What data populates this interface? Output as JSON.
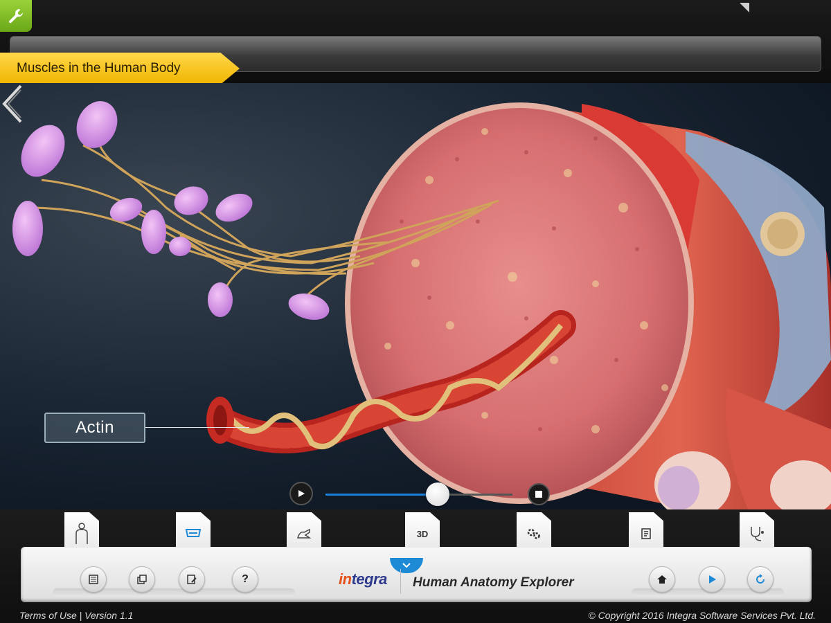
{
  "header": {
    "title": "Muscles in the Human Body"
  },
  "scene": {
    "label": "Actin",
    "playback_progress": 0.6
  },
  "tabs": [
    {
      "id": "body",
      "icon": "human-body-icon",
      "label": ""
    },
    {
      "id": "muscle",
      "icon": "muscle-layer-icon",
      "label": ""
    },
    {
      "id": "draw",
      "icon": "hand-pointer-icon",
      "label": ""
    },
    {
      "id": "3d",
      "icon": "3d-icon",
      "label": "3D"
    },
    {
      "id": "settings",
      "icon": "gears-icon",
      "label": ""
    },
    {
      "id": "notes",
      "icon": "notes-icon",
      "label": ""
    },
    {
      "id": "stethoscope",
      "icon": "stethoscope-icon",
      "label": ""
    }
  ],
  "dock": {
    "left_buttons": [
      {
        "icon": "book-icon",
        "label": ""
      },
      {
        "icon": "copy-windows-icon",
        "label": ""
      },
      {
        "icon": "edit-note-icon",
        "label": ""
      },
      {
        "icon": "help-icon",
        "label": "?"
      }
    ],
    "brand_prefix": "in",
    "brand_suffix": "tegra",
    "app_title": "Human Anatomy Explorer",
    "right_buttons": [
      {
        "icon": "home-icon"
      },
      {
        "icon": "play-icon"
      },
      {
        "icon": "refresh-icon"
      }
    ]
  },
  "footer": {
    "left": "Terms of Use |   Version 1.1",
    "right": "© Copyright 2016 Integra Software Services Pvt. Ltd."
  },
  "colors": {
    "accent_blue": "#1e8ad6",
    "ribbon_yellow": "#f7c51e",
    "tool_green": "#8cc63f"
  }
}
